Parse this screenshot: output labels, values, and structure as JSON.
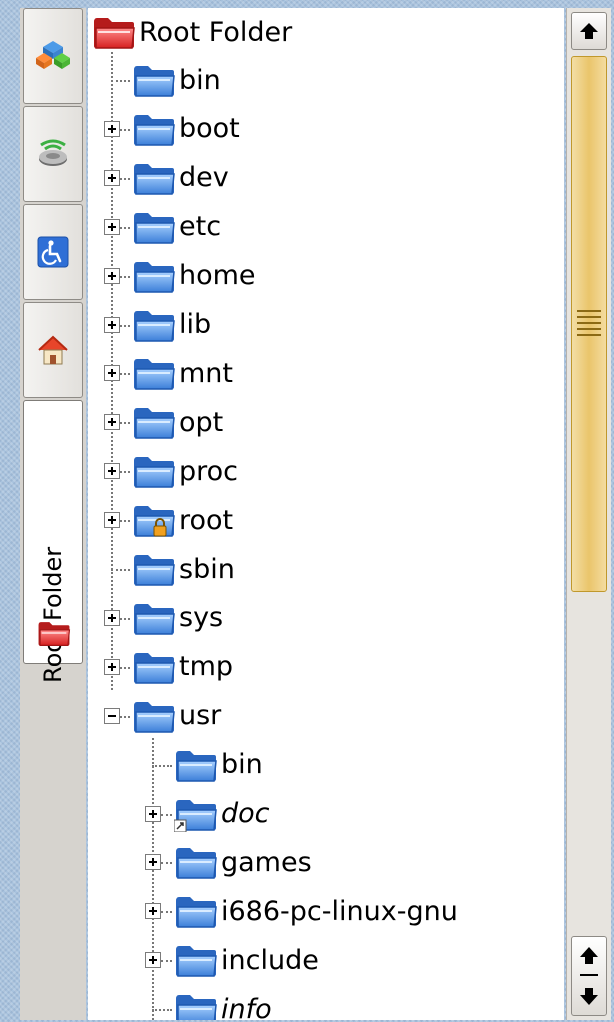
{
  "sidebar": {
    "tabs": [
      {
        "name": "applications",
        "icon": "applications-blocks-icon"
      },
      {
        "name": "network",
        "icon": "network-device-icon"
      },
      {
        "name": "accessibility",
        "icon": "accessibility-icon"
      },
      {
        "name": "home",
        "icon": "home-icon"
      }
    ],
    "active_tab": {
      "label": "Root Folder",
      "icon": "red-folder-icon"
    }
  },
  "tree": {
    "root": {
      "label": "Root Folder",
      "icon": "red-folder-icon"
    },
    "items": [
      {
        "label": "bin",
        "depth": 1,
        "expander": "none"
      },
      {
        "label": "boot",
        "depth": 1,
        "expander": "plus"
      },
      {
        "label": "dev",
        "depth": 1,
        "expander": "plus"
      },
      {
        "label": "etc",
        "depth": 1,
        "expander": "plus"
      },
      {
        "label": "home",
        "depth": 1,
        "expander": "plus"
      },
      {
        "label": "lib",
        "depth": 1,
        "expander": "plus"
      },
      {
        "label": "mnt",
        "depth": 1,
        "expander": "plus"
      },
      {
        "label": "opt",
        "depth": 1,
        "expander": "plus"
      },
      {
        "label": "proc",
        "depth": 1,
        "expander": "plus"
      },
      {
        "label": "root",
        "depth": 1,
        "expander": "plus",
        "locked": true
      },
      {
        "label": "sbin",
        "depth": 1,
        "expander": "none"
      },
      {
        "label": "sys",
        "depth": 1,
        "expander": "plus"
      },
      {
        "label": "tmp",
        "depth": 1,
        "expander": "plus"
      },
      {
        "label": "usr",
        "depth": 1,
        "expander": "minus"
      },
      {
        "label": "bin",
        "depth": 2,
        "expander": "none"
      },
      {
        "label": "doc",
        "depth": 2,
        "expander": "plus",
        "italic": true,
        "symlink": true
      },
      {
        "label": "games",
        "depth": 2,
        "expander": "plus"
      },
      {
        "label": "i686-pc-linux-gnu",
        "depth": 2,
        "expander": "plus"
      },
      {
        "label": "include",
        "depth": 2,
        "expander": "plus"
      },
      {
        "label": "info",
        "depth": 2,
        "expander": "none",
        "italic": true
      }
    ]
  },
  "scrollbar": {
    "up_icon": "arrow-up-icon",
    "down_icon": "arrow-down-icon",
    "position": 0.0,
    "visible_fraction": 0.56
  },
  "colors": {
    "folder_blue": "#4f8fe0",
    "root_folder_red": "#e23b3b",
    "scroll_thumb": "#eac56b",
    "desktop": "#a9c3de"
  }
}
